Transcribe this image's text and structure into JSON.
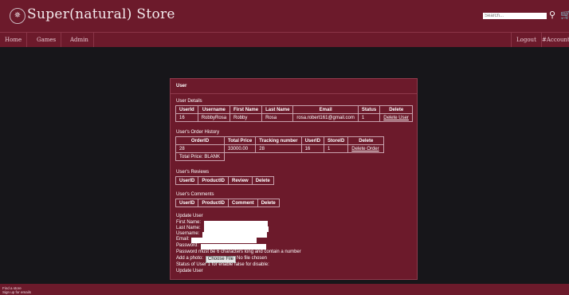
{
  "header": {
    "logo_glyph": "✵",
    "title": "Super(natural) Store",
    "search_placeholder": "Search...",
    "search_icon": "⚲",
    "cart_icon": "🛒"
  },
  "nav": {
    "left": [
      "Home",
      "Games",
      "Admin"
    ],
    "right": [
      "Logout",
      "#Account"
    ]
  },
  "panel": {
    "title": "User",
    "user_details": {
      "heading": "User Details",
      "columns": [
        "UserId",
        "Username",
        "First Name",
        "Last Name",
        "Email",
        "Status",
        "Delete"
      ],
      "row": [
        "16",
        "RobbyRosa",
        "Robby",
        "Rosa",
        "rosa.robert161@gmail.com",
        "1",
        "Delete User"
      ]
    },
    "orders": {
      "heading": "User's Order History",
      "columns": [
        "OrderID",
        "Total Price",
        "Tracking number",
        "UserID",
        "StoreID",
        "Delete"
      ],
      "row": [
        "28",
        "33000.00",
        "28",
        "16",
        "1",
        "Delete Order"
      ],
      "total_label": "Total Price: BLANK"
    },
    "reviews": {
      "heading": "User's Reviews",
      "columns": [
        "UserID",
        "ProductID",
        "Review",
        "Delete"
      ]
    },
    "comments": {
      "heading": "User's Comments",
      "columns": [
        "UserID",
        "ProductID",
        "Comment",
        "Delete"
      ]
    },
    "update": {
      "heading": "Update User",
      "first_name_label": "First Name:",
      "last_name_label": "Last Name:",
      "username_label": "Username:",
      "email_label": "Email:",
      "password_label": "Password:",
      "password_hint": "Password must be 6 characters long and contain a number",
      "photo_label": "Add a photo:",
      "file_button": "Choose File",
      "file_status": "No file chosen",
      "status_label": "Status of User 1 for enable false for disable:",
      "submit_label": "Update User"
    }
  },
  "footer": {
    "line1": "Find a store",
    "line2": "Sign up for emails"
  }
}
